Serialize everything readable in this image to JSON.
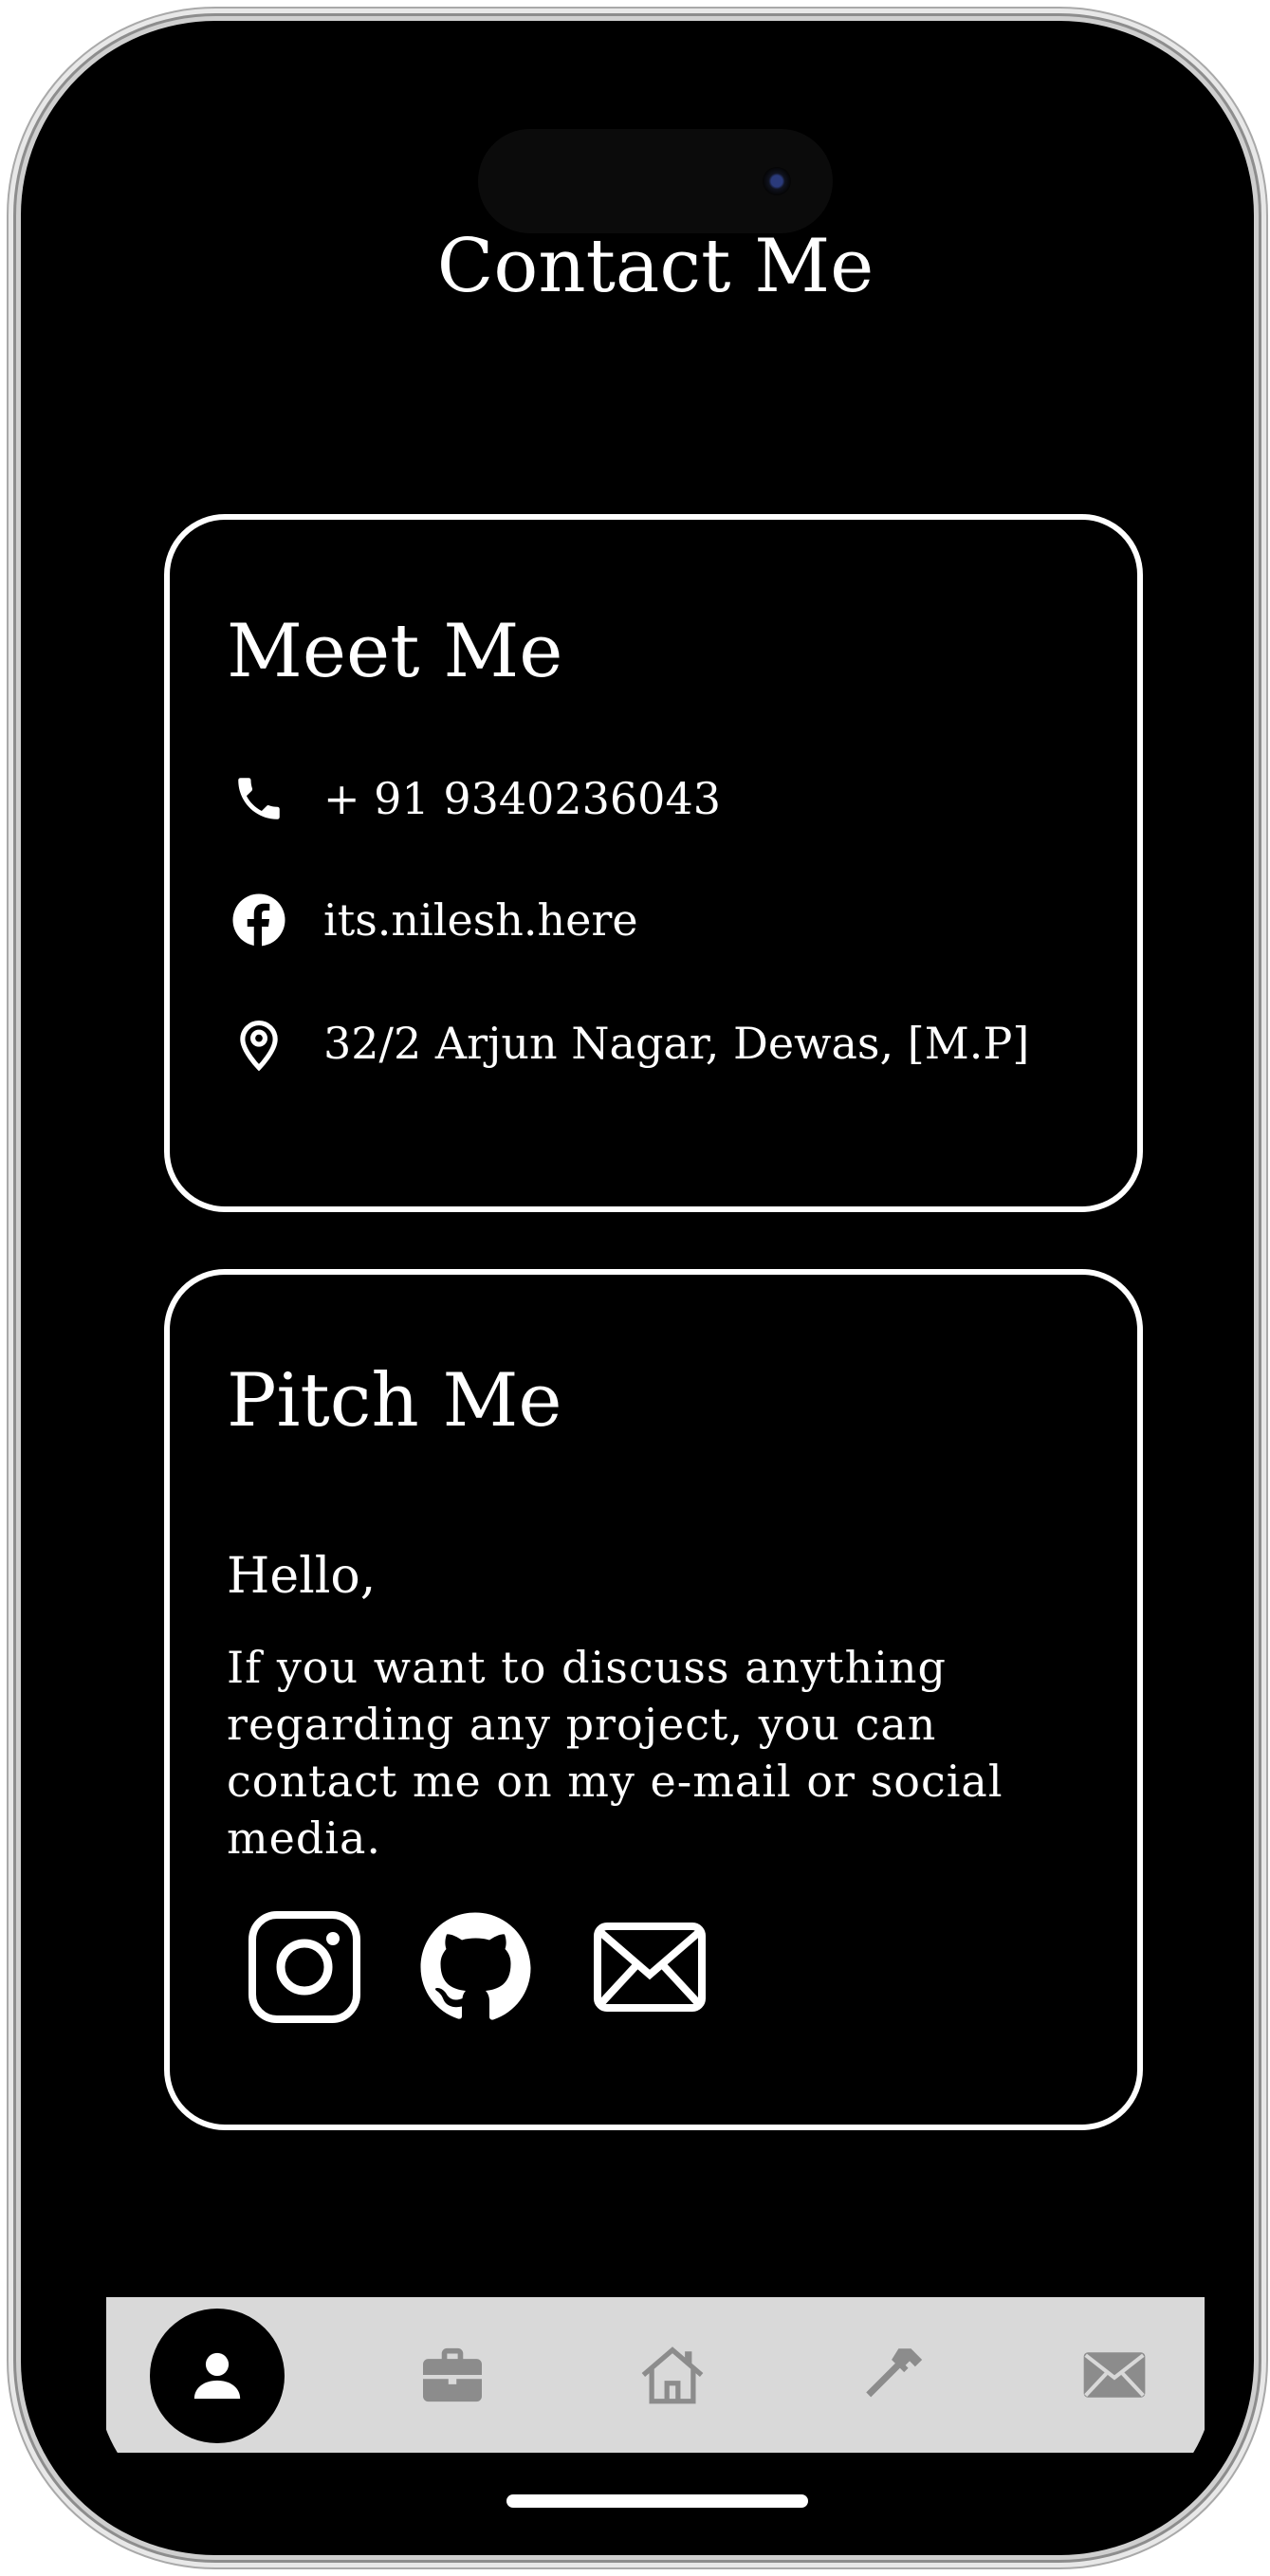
{
  "page": {
    "title": "Contact Me"
  },
  "meet_card": {
    "title": "Meet Me",
    "items": [
      {
        "icon": "phone-icon",
        "text": "+ 91 9340236043"
      },
      {
        "icon": "facebook-icon",
        "text": "its.nilesh.here"
      },
      {
        "icon": "location-pin-icon",
        "text": "32/2 Arjun Nagar, Dewas, [M.P]"
      }
    ]
  },
  "pitch_card": {
    "title": "Pitch Me",
    "greeting": "Hello,",
    "message": "If you want to discuss anything regarding any project, you can contact me on my e-mail or social media.",
    "socials": [
      "instagram-icon",
      "github-icon",
      "mail-icon"
    ]
  },
  "tab_bar": {
    "active": "profile",
    "tabs": [
      "profile-icon",
      "briefcase-icon",
      "home-icon",
      "hammer-icon",
      "mail-icon"
    ],
    "active_bg": "#000000",
    "bar_bg": "#d9d9d9",
    "inactive_icon_color": "#8c8c8c"
  },
  "colors": {
    "background": "#000000",
    "foreground": "#ffffff"
  }
}
